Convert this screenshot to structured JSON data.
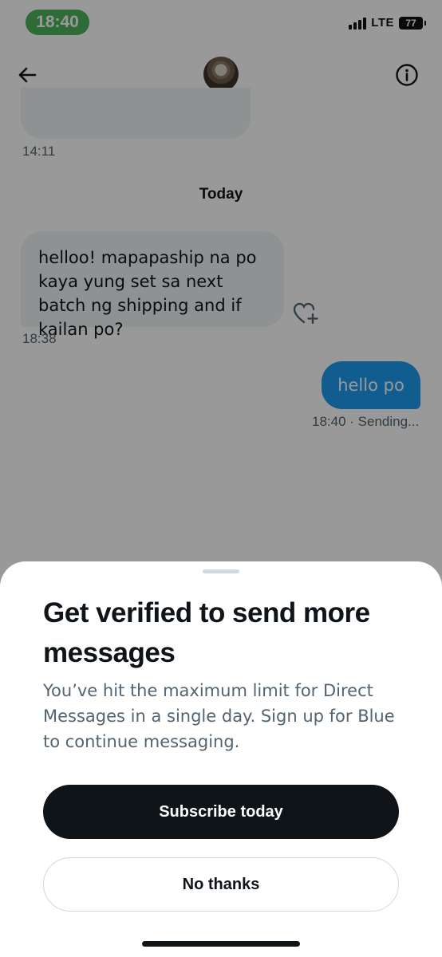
{
  "status_bar": {
    "time": "18:40",
    "network": "LTE",
    "battery": "77"
  },
  "header": {
    "back_icon": "arrow-left-icon",
    "avatar": "profile-avatar",
    "info_icon": "info-circle-icon"
  },
  "conversation": {
    "previous_message_time": "14:11",
    "day_separator": "Today",
    "received_message": {
      "text": "helloo! mapapaship na po kaya yung set sa next batch ng shipping and if kailan po?",
      "time": "18:38",
      "reaction_icon": "heart-plus-icon"
    },
    "sent_message": {
      "text": "hello po",
      "time": "18:40",
      "status": "· Sending..."
    }
  },
  "sheet": {
    "title": "Get verified to send more messages",
    "body": "You’ve hit the maximum limit for Direct Messages in a single day. Sign up for Blue to continue messaging.",
    "primary_button": "Subscribe today",
    "secondary_button": "No thanks"
  },
  "colors": {
    "accent": "#1d9bf0",
    "status_time_bg": "#4fb25a",
    "primary_button_bg": "#0f1419",
    "secondary_text": "#536471"
  }
}
